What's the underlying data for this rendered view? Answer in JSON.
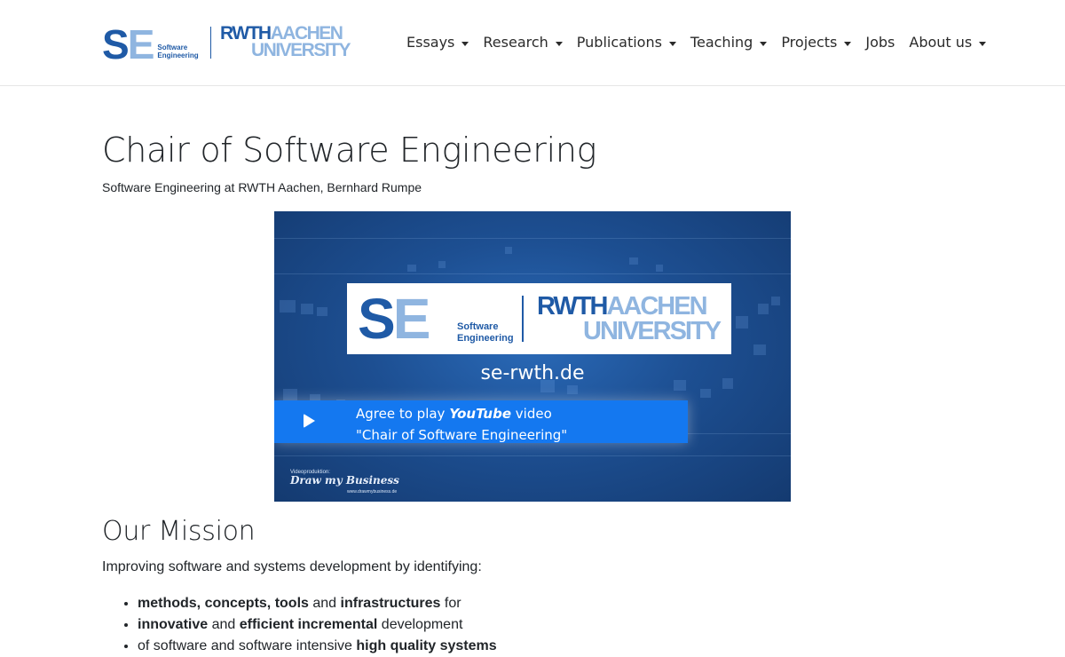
{
  "header": {
    "se_logo": {
      "letters_s": "S",
      "letters_e": "E",
      "sub_line1": "Software",
      "sub_line2": "Engineering"
    },
    "rwth_logo": {
      "part1": "RWTH",
      "part2": "AACHEN",
      "part3": "UNIVERSITY"
    },
    "nav": [
      {
        "label": "Essays",
        "dropdown": true
      },
      {
        "label": "Research",
        "dropdown": true
      },
      {
        "label": "Publications",
        "dropdown": true
      },
      {
        "label": "Teaching",
        "dropdown": true
      },
      {
        "label": "Projects",
        "dropdown": true
      },
      {
        "label": "Jobs",
        "dropdown": false
      },
      {
        "label": "About us",
        "dropdown": true
      }
    ]
  },
  "page": {
    "title": "Chair of Software Engineering",
    "subtitle": "Software Engineering at RWTH Aachen, Bernhard Rumpe"
  },
  "video": {
    "logo_s": "S",
    "logo_e": "E",
    "logo_sub1": "Software",
    "logo_sub2": "Engineering",
    "logo_rwth": "RWTH",
    "logo_aachen": "AACHEN",
    "logo_university": "UNIVERSITY",
    "url_text": "se-rwth.de",
    "consent_prefix": "Agree to play ",
    "consent_brand": "YouTube",
    "consent_suffix": " video",
    "consent_title": "\"Chair of Software Engineering\"",
    "credit_small": "Videoproduktion:",
    "credit": "Draw my Business",
    "credit_url": "www.drawmybusiness.de"
  },
  "mission": {
    "heading": "Our Mission",
    "intro": "Improving software and systems development by identifying:",
    "items": [
      [
        {
          "t": "methods, concepts, tools",
          "b": true
        },
        {
          "t": " and ",
          "b": false
        },
        {
          "t": "infrastructures",
          "b": true
        },
        {
          "t": " for",
          "b": false
        }
      ],
      [
        {
          "t": "innovative",
          "b": true
        },
        {
          "t": " and ",
          "b": false
        },
        {
          "t": "efficient incremental",
          "b": true
        },
        {
          "t": " development",
          "b": false
        }
      ],
      [
        {
          "t": "of software and software intensive ",
          "b": false
        },
        {
          "t": "high quality systems",
          "b": true
        }
      ]
    ]
  },
  "colors": {
    "brand_dark": "#1f5aa6",
    "brand_light": "#8fb5e0",
    "consent_blue": "#1478f0"
  }
}
